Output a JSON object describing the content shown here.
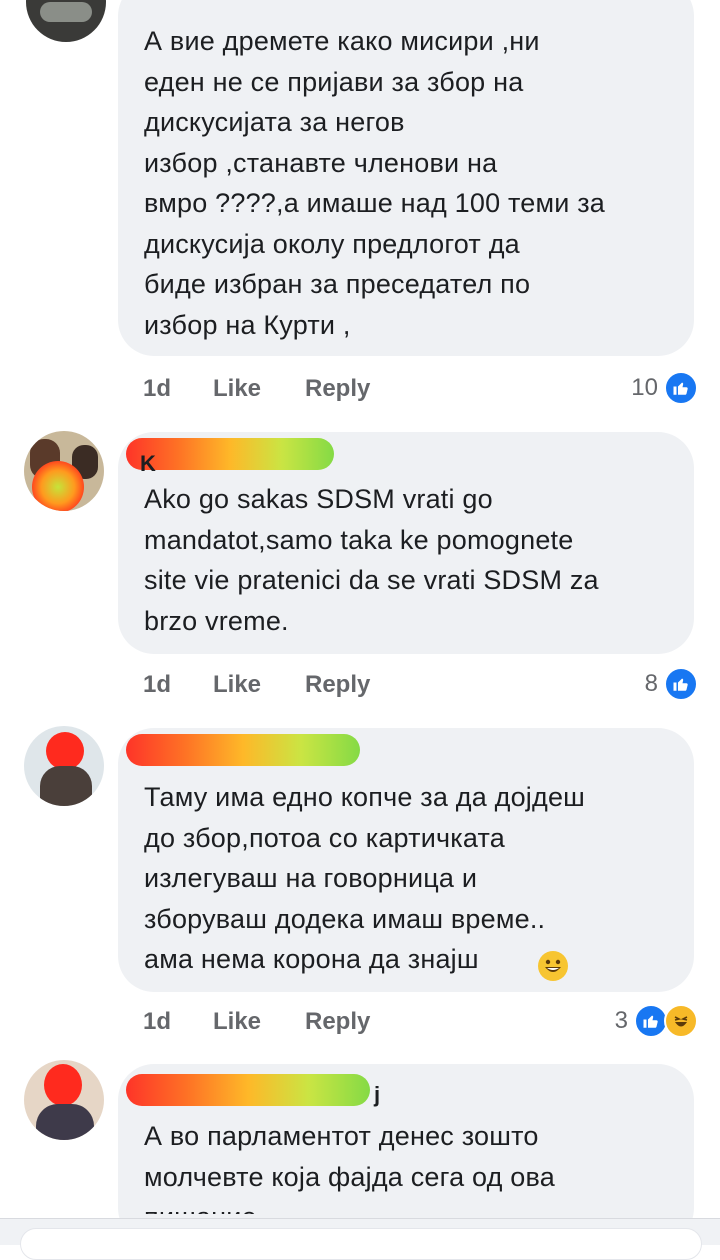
{
  "comments": [
    {
      "text": "А вие дремете како мисири ,ни\nеден не се пријави за збор на\nдискусијата  за негов\nизбор ,станавте членови на\nвмро ????,а имаше над 100 теми за\nдискусија околу предлогот  да\nбиде избран за преседател по\nизбор на Курти ,",
      "time": "1d",
      "like_label": "Like",
      "reply_label": "Reply",
      "reaction_count": "10",
      "reactions": [
        "like-icon"
      ]
    },
    {
      "author_stub": "K",
      "text": "Ako go sakas SDSM vrati go\nmandatot,samo taka ke pomognete\nsite vie pratenici da se vrati SDSM za\nbrzo vreme.",
      "time": "1d",
      "like_label": "Like",
      "reply_label": "Reply",
      "reaction_count": "8",
      "reactions": [
        "like-icon"
      ]
    },
    {
      "text": "Таму има едно копче за да дојдеш\nдо збор,потоа со картичката\nизлегуваш на говорница и\nзборуваш додека имаш време..\nама нема корона да знајш",
      "time": "1d",
      "like_label": "Like",
      "reply_label": "Reply",
      "reaction_count": "3",
      "reactions": [
        "like-icon",
        "haha-icon"
      ]
    },
    {
      "author_stub": "j",
      "text": "А во парламентот  денес зошто\nмолчевте која фајда сега од ова\nпишание"
    }
  ],
  "colors": {
    "like_blue": "#1877f2",
    "haha_yellow": "#f7b928",
    "bubble": "#eff1f4",
    "meta_gray": "#65676b"
  }
}
